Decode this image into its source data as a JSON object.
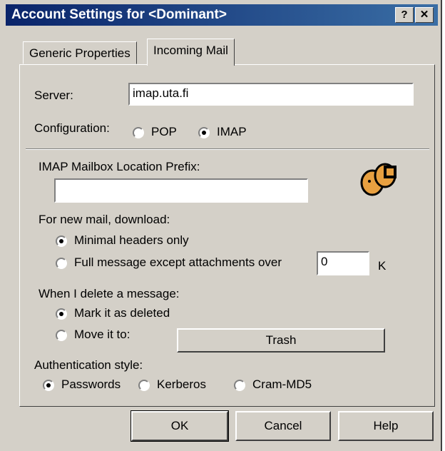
{
  "window": {
    "title": "Account Settings for <Dominant>",
    "help_button": "?",
    "close_button": "✕"
  },
  "tabs": [
    {
      "label": "Generic Properties"
    },
    {
      "label": "Incoming Mail"
    }
  ],
  "server": {
    "label": "Server:",
    "value": "imap.uta.fi"
  },
  "configuration": {
    "label": "Configuration:",
    "options": [
      {
        "label": "POP",
        "checked": false
      },
      {
        "label": "IMAP",
        "checked": true
      }
    ]
  },
  "imap_prefix": {
    "label": "IMAP Mailbox Location Prefix:",
    "value": ""
  },
  "download": {
    "label": "For new mail, download:",
    "options": [
      {
        "label": "Minimal headers only",
        "checked": true
      },
      {
        "label": "Full message except attachments over",
        "checked": false
      }
    ],
    "size_value": "0",
    "size_unit": "K"
  },
  "delete": {
    "label": "When I delete a message:",
    "options": [
      {
        "label": "Mark it as deleted",
        "checked": true
      },
      {
        "label": "Move it to:",
        "checked": false
      }
    ],
    "folder_button": "Trash"
  },
  "auth": {
    "label": "Authentication style:",
    "options": [
      {
        "label": "Passwords",
        "checked": true
      },
      {
        "label": "Kerberos",
        "checked": false
      },
      {
        "label": "Cram-MD5",
        "checked": false
      }
    ]
  },
  "buttons": {
    "ok": "OK",
    "cancel": "Cancel",
    "help": "Help"
  },
  "icon": "users-icon"
}
